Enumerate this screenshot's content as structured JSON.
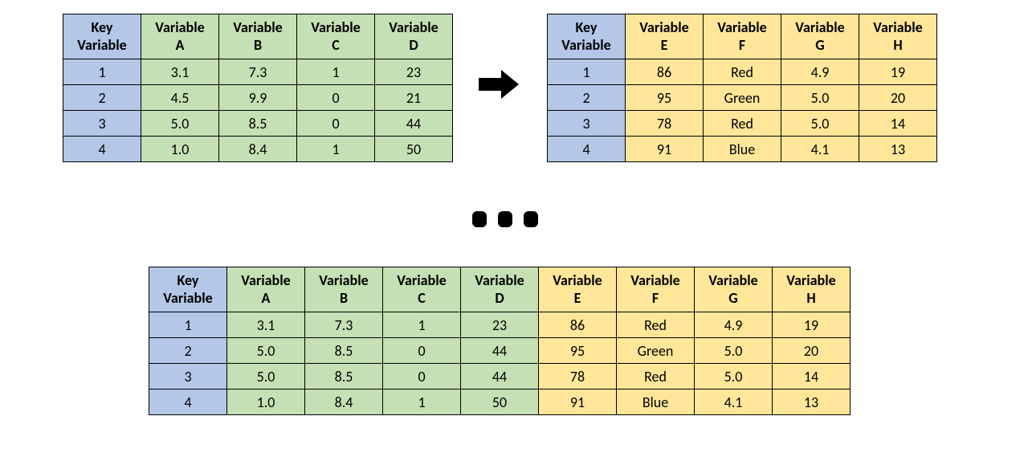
{
  "colors": {
    "key_bg": "#b4c7e7",
    "green_bg": "#c5e0b4",
    "yellow_bg": "#ffe699"
  },
  "table_left": {
    "headers": {
      "key": "Key\nVariable",
      "c0": "Variable\nA",
      "c1": "Variable\nB",
      "c2": "Variable\nC",
      "c3": "Variable\nD"
    },
    "rows": [
      {
        "key": "1",
        "v": [
          "3.1",
          "7.3",
          "1",
          "23"
        ]
      },
      {
        "key": "2",
        "v": [
          "4.5",
          "9.9",
          "0",
          "21"
        ]
      },
      {
        "key": "3",
        "v": [
          "5.0",
          "8.5",
          "0",
          "44"
        ]
      },
      {
        "key": "4",
        "v": [
          "1.0",
          "8.4",
          "1",
          "50"
        ]
      }
    ]
  },
  "table_right": {
    "headers": {
      "key": "Key\nVariable",
      "c0": "Variable\nE",
      "c1": "Variable\nF",
      "c2": "Variable\nG",
      "c3": "Variable\nH"
    },
    "rows": [
      {
        "key": "1",
        "v": [
          "86",
          "Red",
          "4.9",
          "19"
        ]
      },
      {
        "key": "2",
        "v": [
          "95",
          "Green",
          "5.0",
          "20"
        ]
      },
      {
        "key": "3",
        "v": [
          "78",
          "Red",
          "5.0",
          "14"
        ]
      },
      {
        "key": "4",
        "v": [
          "91",
          "Blue",
          "4.1",
          "13"
        ]
      }
    ]
  },
  "table_merged": {
    "headers": {
      "key": "Key\nVariable",
      "g0": "Variable\nA",
      "g1": "Variable\nB",
      "g2": "Variable\nC",
      "g3": "Variable\nD",
      "y0": "Variable\nE",
      "y1": "Variable\nF",
      "y2": "Variable\nG",
      "y3": "Variable\nH"
    },
    "rows": [
      {
        "key": "1",
        "g": [
          "3.1",
          "7.3",
          "1",
          "23"
        ],
        "y": [
          "86",
          "Red",
          "4.9",
          "19"
        ]
      },
      {
        "key": "2",
        "g": [
          "5.0",
          "8.5",
          "0",
          "44"
        ],
        "y": [
          "95",
          "Green",
          "5.0",
          "20"
        ]
      },
      {
        "key": "3",
        "g": [
          "5.0",
          "8.5",
          "0",
          "44"
        ],
        "y": [
          "78",
          "Red",
          "5.0",
          "14"
        ]
      },
      {
        "key": "4",
        "g": [
          "1.0",
          "8.4",
          "1",
          "50"
        ],
        "y": [
          "91",
          "Blue",
          "4.1",
          "13"
        ]
      }
    ]
  },
  "chart_data": [
    {
      "type": "table",
      "title": "Source table A-D",
      "columns": [
        "Key Variable",
        "Variable A",
        "Variable B",
        "Variable C",
        "Variable D"
      ],
      "rows": [
        [
          1,
          3.1,
          7.3,
          1,
          23
        ],
        [
          2,
          4.5,
          9.9,
          0,
          21
        ],
        [
          3,
          5.0,
          8.5,
          0,
          44
        ],
        [
          4,
          1.0,
          8.4,
          1,
          50
        ]
      ]
    },
    {
      "type": "table",
      "title": "Source table E-H",
      "columns": [
        "Key Variable",
        "Variable E",
        "Variable F",
        "Variable G",
        "Variable H"
      ],
      "rows": [
        [
          1,
          86,
          "Red",
          4.9,
          19
        ],
        [
          2,
          95,
          "Green",
          5.0,
          20
        ],
        [
          3,
          78,
          "Red",
          5.0,
          14
        ],
        [
          4,
          91,
          "Blue",
          4.1,
          13
        ]
      ]
    },
    {
      "type": "table",
      "title": "Merged table",
      "columns": [
        "Key Variable",
        "Variable A",
        "Variable B",
        "Variable C",
        "Variable D",
        "Variable E",
        "Variable F",
        "Variable G",
        "Variable H"
      ],
      "rows": [
        [
          1,
          3.1,
          7.3,
          1,
          23,
          86,
          "Red",
          4.9,
          19
        ],
        [
          2,
          5.0,
          8.5,
          0,
          44,
          95,
          "Green",
          5.0,
          20
        ],
        [
          3,
          5.0,
          8.5,
          0,
          44,
          78,
          "Red",
          5.0,
          14
        ],
        [
          4,
          1.0,
          8.4,
          1,
          50,
          91,
          "Blue",
          4.1,
          13
        ]
      ]
    }
  ]
}
